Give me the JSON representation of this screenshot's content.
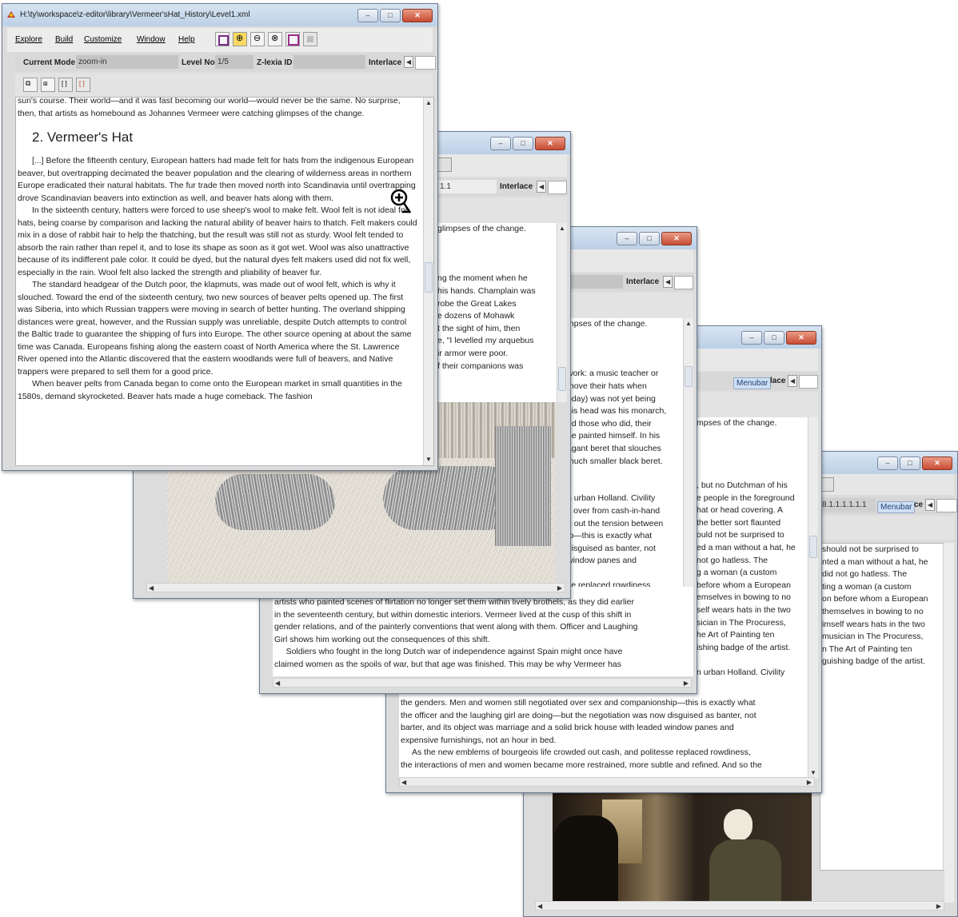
{
  "main_window": {
    "title": "H:\\ty\\workspace\\z-editor\\library\\Vermeer'sHat_History\\Level1.xml",
    "menu": [
      "Explore",
      "Build",
      "Customize",
      "Window",
      "Help"
    ],
    "current_mode_label": "Current Mode",
    "current_mode_value": "zoom-in",
    "level_no_label": "Level No",
    "level_no_value": "1/5",
    "zlexia_label": "Z-lexia ID",
    "zlexia_value": "",
    "interlace_label": "Interlace",
    "text_top": "sun's course. Their world—and it was fast becoming our world—would never be the same. No surprise, then, that artists as homebound as Johannes Vermeer were catching glimpses of the change.",
    "heading": "2. Vermeer's Hat",
    "paragraphs": [
      "[...] Before the fifteenth century, European hatters had made felt for hats from the indigenous European beaver, but overtrapping decimated the beaver population and the clearing of wilderness areas in northern Europe eradicated their natural habitats. The fur trade then moved north into Scandinavia until overtrapping drove Scandinavian beavers into extinction as well, and beaver hats along with them.",
      "In the sixteenth century, hatters were forced to use sheep's wool to make felt. Wool felt is not ideal for hats, being coarse by comparison and lacking the natural ability of beaver hairs to thatch. Felt makers could mix in a dose of rabbit hair to help the thatching, but the result was still not as sturdy. Wool felt tended to absorb the rain rather than repel it, and to lose its shape as soon as it got wet. Wool was also unattractive because of its indifferent pale color. It could be dyed, but the natural dyes felt makers used did not fix well, especially in the rain. Wool felt also lacked the strength and pliability of beaver fur.",
      "The standard headgear of the Dutch poor, the klapmuts, was made out of wool felt, which is why it slouched. Toward the end of the sixteenth century, two new sources of beaver pelts opened up. The first was Siberia, into which Russian trappers were moving in search of better hunting. The overland shipping distances were great, however, and the Russian supply was unreliable, despite Dutch attempts to control the Baltic trade to guarantee the shipping of furs into Europe. The other source opening at about the same time was Canada. Europeans fishing along the eastern coast of North America where the St. Lawrence River opened into the Atlantic discovered that the eastern woodlands were full of beavers, and Native trappers were prepared to sell them for a good price.",
      "When beaver pelts from Canada began to come onto the European market in small quantities in the 1580s, demand skyrocketed. Beaver hats made a huge comeback. The fashion"
    ]
  },
  "window2": {
    "id_field": "1.1",
    "interlace_label": "Interlace",
    "lines": [
      "glimpses of the change.",
      "",
      "",
      "",
      "ng the moment when he",
      "his hands. Champlain was",
      "robe the Great Lakes",
      "e dozens of Mohawk",
      "t the sight of him, then",
      "e, \"I levelled my arquebus",
      "ir armor were poor.",
      "f their companions was"
    ]
  },
  "window3": {
    "interlace_label": "Interlace",
    "lines_right": [
      "mpses of the change.",
      "",
      "",
      "",
      "work: a music teacher or",
      "move their hats when",
      "oday) was not yet being",
      "his head was his monarch,",
      "ed those who did, their",
      "he painted himself. In his",
      "agant beret that slouches",
      "much smaller black beret.",
      "",
      "",
      "n urban Holland. Civility",
      "k over from cash-in-hand",
      "g out the tension between",
      "ip—this is exactly what",
      "disguised as banter, not",
      "window panes and",
      "",
      "se replaced rowdiness,",
      "e and refined. And so the"
    ],
    "lines_bottom": [
      "artists who painted scenes of flirtation no longer set them within lively brothels, as they did earlier",
      "in the seventeenth century, but within domestic interiors. Vermeer lived at the cusp of this shift in",
      "gender relations, and of the painterly conventions that went along with them. Officer and Laughing",
      "Girl shows him working out the consequences of this shift.",
      "     Soldiers who fought in the long Dutch war of independence against Spain might once have",
      "claimed women as the spoils of war, but that age was finished. This may be why Vermeer has"
    ]
  },
  "window4": {
    "menubar_tag": "Menubar",
    "interlace_suffix": "lace",
    "lines_right": [
      "mpses of the change.",
      "",
      "",
      "",
      "",
      ", but no Dutchman of his",
      "e people in the foreground",
      "hat or head covering. A",
      "the better sort flaunted",
      "ould not be surprised to",
      "ed a man without a hat, he",
      "not go hatless. The",
      "g a woman (a custom",
      "before whom a European",
      "emselves in bowing to no",
      "self wears hats in the two",
      "sician in The Procuress,",
      "he Art of Painting ten",
      "ishing badge of the artist.",
      "",
      "n urban Holland. Civility",
      "k over from cash-in-hand",
      "g out the tension between"
    ],
    "lines_bottom": [
      "the genders. Men and women still negotiated over sex and companionship—this is exactly what",
      "the officer and the laughing girl are doing—but the negotiation was now disguised as banter, not",
      "barter, and its object was marriage and a solid brick house with leaded window panes and",
      "expensive furnishings, not an hour in bed.",
      "     As the new emblems of bourgeois life crowded out cash, and politesse replaced rowdiness,",
      "the interactions of men and women became more restrained, more subtle and refined. And so the"
    ]
  },
  "window5": {
    "id_field": "8.1.1.1.1.1.1",
    "menubar_tag": "Menubar",
    "interlace_suffix": "ce",
    "lines": [
      "should not be surprised to",
      "nted a man without a hat, he",
      "did not go hatless. The",
      "ting a woman (a custom",
      "on before whom a European",
      "themselves in bowing to no",
      "imself wears hats in the two",
      "musician in The Procuress,",
      "n The Art of Painting ten",
      "guishing badge of the artist."
    ]
  },
  "colors": {
    "titlebar": "#c9d9ec",
    "close": "#c84b33",
    "panel": "#dcdcdc"
  }
}
